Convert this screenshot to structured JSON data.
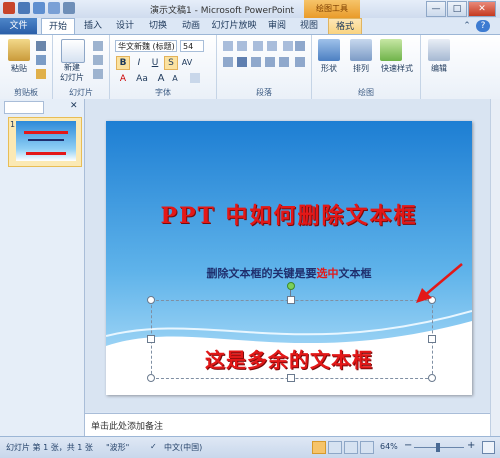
{
  "window": {
    "title": "演示文稿1 - Microsoft PowerPoint",
    "context_tools_label": "绘图工具",
    "controls": {
      "minimize": "—",
      "maximize": "□",
      "close": "✕"
    }
  },
  "tabs": {
    "file": "文件",
    "home": "开始",
    "insert": "插入",
    "design": "设计",
    "transitions": "切换",
    "animations": "动画",
    "slideshow": "幻灯片放映",
    "review": "审阅",
    "view": "视图",
    "format": "格式"
  },
  "ribbon": {
    "clipboard": {
      "label": "剪贴板",
      "paste": "粘贴"
    },
    "slides": {
      "label": "幻灯片",
      "new_slide_line1": "新建",
      "new_slide_line2": "幻灯片"
    },
    "font": {
      "label": "字体",
      "font_name": "华文新魏 (标题)",
      "font_size": "54",
      "bold": "B",
      "italic": "I",
      "underline": "U",
      "strike": "S",
      "grow": "A",
      "shrink": "A",
      "aa": "Aa"
    },
    "paragraph": {
      "label": "段落"
    },
    "drawing": {
      "label": "绘图",
      "shapes": "形状",
      "arrange": "排列",
      "quick_styles": "快速样式"
    },
    "editing": {
      "label": "编辑"
    }
  },
  "thumbnail": {
    "number": "1"
  },
  "slide": {
    "title": "PPT 中如何删除文本框",
    "subtitle_pre": "删除文本框的关键是要",
    "subtitle_hl": "选中",
    "subtitle_post": "文本框",
    "extra_text": "这是多余的文本框"
  },
  "notes": {
    "placeholder": "单击此处添加备注"
  },
  "status": {
    "slide_info": "幻灯片 第 1 张，共 1 张",
    "theme": "\"波形\"",
    "language": "中文(中国)",
    "zoom": "64%",
    "zoom_out": "−",
    "zoom_in": "+"
  },
  "colors": {
    "title_red": "#e31818",
    "subtitle_navy": "#1f2f6e",
    "file_tab": "#2a5ea8",
    "context_orange": "#e99b2a"
  }
}
